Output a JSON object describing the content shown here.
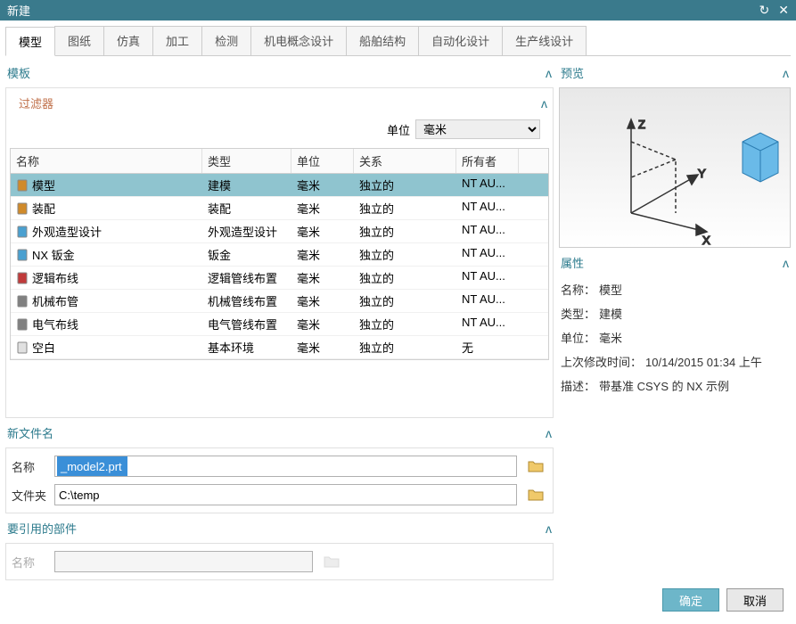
{
  "window": {
    "title": "新建"
  },
  "tabs": [
    "模型",
    "图纸",
    "仿真",
    "加工",
    "检测",
    "机电概念设计",
    "船舶结构",
    "自动化设计",
    "生产线设计"
  ],
  "active_tab": 0,
  "template": {
    "heading": "模板",
    "filter_heading": "过滤器",
    "unit_label": "单位",
    "unit_value": "毫米",
    "columns": {
      "name": "名称",
      "type": "类型",
      "unit": "单位",
      "relation": "关系",
      "owner": "所有者"
    },
    "rows": [
      {
        "name": "模型",
        "type": "建模",
        "unit": "毫米",
        "relation": "独立的",
        "owner": "NT AU...",
        "icon": "#d08a2a",
        "selected": true
      },
      {
        "name": "装配",
        "type": "装配",
        "unit": "毫米",
        "relation": "独立的",
        "owner": "NT AU...",
        "icon": "#d08a2a"
      },
      {
        "name": "外观造型设计",
        "type": "外观造型设计",
        "unit": "毫米",
        "relation": "独立的",
        "owner": "NT AU...",
        "icon": "#4aa0d0"
      },
      {
        "name": "NX 钣金",
        "type": "钣金",
        "unit": "毫米",
        "relation": "独立的",
        "owner": "NT AU...",
        "icon": "#4aa0d0"
      },
      {
        "name": "逻辑布线",
        "type": "逻辑管线布置",
        "unit": "毫米",
        "relation": "独立的",
        "owner": "NT AU...",
        "icon": "#c03a3a"
      },
      {
        "name": "机械布管",
        "type": "机械管线布置",
        "unit": "毫米",
        "relation": "独立的",
        "owner": "NT AU...",
        "icon": "#808080"
      },
      {
        "name": "电气布线",
        "type": "电气管线布置",
        "unit": "毫米",
        "relation": "独立的",
        "owner": "NT AU...",
        "icon": "#808080"
      },
      {
        "name": "空白",
        "type": "基本环境",
        "unit": "毫米",
        "relation": "独立的",
        "owner": "无",
        "icon": "#e0e0e0"
      }
    ]
  },
  "preview": {
    "heading": "预览"
  },
  "properties": {
    "heading": "属性",
    "name_label": "名称：",
    "name_value": "模型",
    "type_label": "类型：",
    "type_value": "建模",
    "unit_label": "单位：",
    "unit_value": "毫米",
    "modified_label": "上次修改时间：",
    "modified_value": "10/14/2015 01:34 上午",
    "desc_label": "描述：",
    "desc_value": "带基准 CSYS 的 NX 示例"
  },
  "new_file": {
    "heading": "新文件名",
    "name_label": "名称",
    "name_value": "_model2.prt",
    "folder_label": "文件夹",
    "folder_value": "C:\\temp"
  },
  "ref_part": {
    "heading": "要引用的部件",
    "name_label": "名称",
    "name_value": ""
  },
  "footer": {
    "ok": "确定",
    "cancel": "取消"
  }
}
